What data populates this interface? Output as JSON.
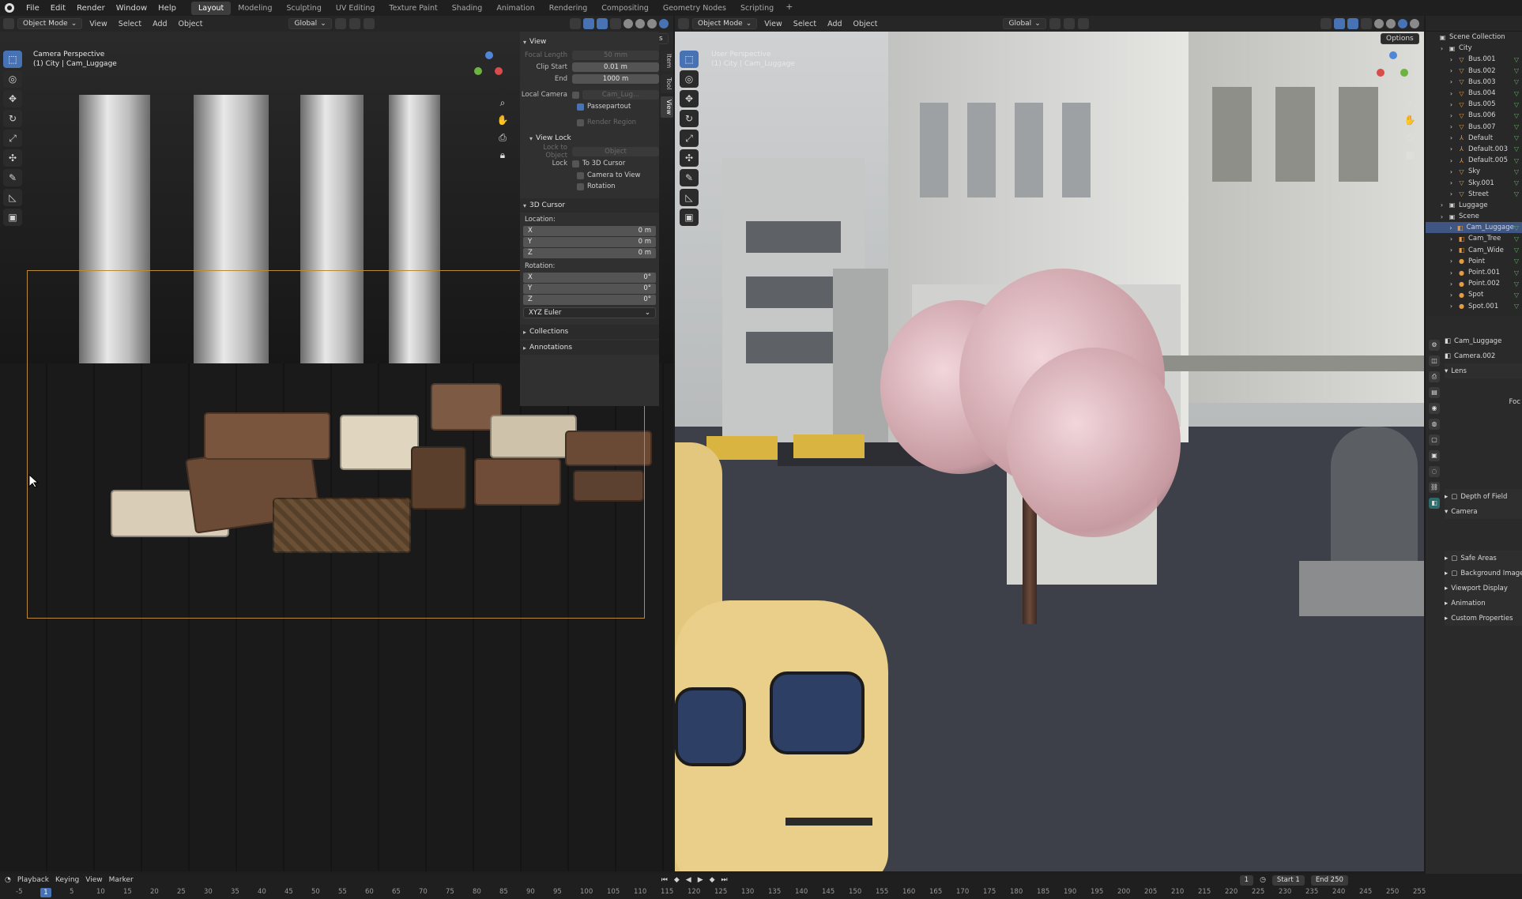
{
  "menu": {
    "items": [
      "File",
      "Edit",
      "Render",
      "Window",
      "Help"
    ],
    "workspaces": [
      "Layout",
      "Modeling",
      "Sculpting",
      "UV Editing",
      "Texture Paint",
      "Shading",
      "Animation",
      "Rendering",
      "Compositing",
      "Geometry Nodes",
      "Scripting"
    ],
    "active_workspace": "Layout",
    "add_tab": "+"
  },
  "left_viewport": {
    "mode": "Object Mode",
    "menus": [
      "View",
      "Select",
      "Add",
      "Object"
    ],
    "orientation": "Global",
    "options": "Options",
    "overlay_line1": "Camera Perspective",
    "overlay_line2": "(1) City | Cam_Luggage"
  },
  "npanel": {
    "tabs": [
      "Item",
      "Tool",
      "View"
    ],
    "view_header": "View",
    "focal_length_label": "Focal Length",
    "focal_length_value": "50 mm",
    "clip_start_label": "Clip Start",
    "clip_start_value": "0.01 m",
    "end_label": "End",
    "end_value": "1000 m",
    "local_camera_label": "Local Camera",
    "local_camera_value": "Cam_Lug...",
    "passepartout": "Passepartout",
    "render_region": "Render Region",
    "view_lock_header": "View Lock",
    "lock_to_object_label": "Lock to Object",
    "lock_to_object_value": "Object",
    "lock_label": "Lock",
    "to_3d_cursor": "To 3D Cursor",
    "camera_to_view": "Camera to View",
    "rotation_check": "Rotation",
    "cursor_header": "3D Cursor",
    "location_label": "Location:",
    "location": [
      {
        "axis": "X",
        "value": "0 m"
      },
      {
        "axis": "Y",
        "value": "0 m"
      },
      {
        "axis": "Z",
        "value": "0 m"
      }
    ],
    "rotation_label": "Rotation:",
    "rotation": [
      {
        "axis": "X",
        "value": "0°"
      },
      {
        "axis": "Y",
        "value": "0°"
      },
      {
        "axis": "Z",
        "value": "0°"
      }
    ],
    "rotation_mode": "XYZ Euler",
    "collections_header": "Collections",
    "annotations_header": "Annotations"
  },
  "right_viewport": {
    "mode": "Object Mode",
    "menus": [
      "View",
      "Select",
      "Add",
      "Object"
    ],
    "orientation": "Global",
    "options": "Options",
    "overlay_line1": "User Perspective",
    "overlay_line2": "(1) City | Cam_Luggage"
  },
  "outliner": {
    "rows": [
      {
        "name": "Scene Collection",
        "indent": 0,
        "icon": "▣",
        "color": "#cfcfcf"
      },
      {
        "name": "City",
        "indent": 1,
        "icon": "▣",
        "color": "#cfcfcf"
      },
      {
        "name": "Bus.001",
        "indent": 2,
        "icon": "▽",
        "color": "#e89a3c"
      },
      {
        "name": "Bus.002",
        "indent": 2,
        "icon": "▽",
        "color": "#e89a3c"
      },
      {
        "name": "Bus.003",
        "indent": 2,
        "icon": "▽",
        "color": "#e89a3c"
      },
      {
        "name": "Bus.004",
        "indent": 2,
        "icon": "▽",
        "color": "#e89a3c"
      },
      {
        "name": "Bus.005",
        "indent": 2,
        "icon": "▽",
        "color": "#e89a3c"
      },
      {
        "name": "Bus.006",
        "indent": 2,
        "icon": "▽",
        "color": "#e89a3c"
      },
      {
        "name": "Bus.007",
        "indent": 2,
        "icon": "▽",
        "color": "#e89a3c"
      },
      {
        "name": "Default",
        "indent": 2,
        "icon": "⅄",
        "color": "#e89a3c"
      },
      {
        "name": "Default.003",
        "indent": 2,
        "icon": "⅄",
        "color": "#e89a3c"
      },
      {
        "name": "Default.005",
        "indent": 2,
        "icon": "⅄",
        "color": "#e89a3c"
      },
      {
        "name": "Sky",
        "indent": 2,
        "icon": "▽",
        "color": "#e89a3c"
      },
      {
        "name": "Sky.001",
        "indent": 2,
        "icon": "▽",
        "color": "#e89a3c"
      },
      {
        "name": "Street",
        "indent": 2,
        "icon": "▽",
        "color": "#e89a3c"
      },
      {
        "name": "Luggage",
        "indent": 1,
        "icon": "▣",
        "color": "#cfcfcf"
      },
      {
        "name": "Scene",
        "indent": 1,
        "icon": "▣",
        "color": "#cfcfcf"
      },
      {
        "name": "Cam_Luggage",
        "indent": 2,
        "icon": "◧",
        "color": "#e89a3c",
        "selected": true
      },
      {
        "name": "Cam_Tree",
        "indent": 2,
        "icon": "◧",
        "color": "#e89a3c"
      },
      {
        "name": "Cam_Wide",
        "indent": 2,
        "icon": "◧",
        "color": "#e89a3c"
      },
      {
        "name": "Point",
        "indent": 2,
        "icon": "●",
        "color": "#e89a3c"
      },
      {
        "name": "Point.001",
        "indent": 2,
        "icon": "●",
        "color": "#e89a3c"
      },
      {
        "name": "Point.002",
        "indent": 2,
        "icon": "●",
        "color": "#e89a3c"
      },
      {
        "name": "Spot",
        "indent": 2,
        "icon": "●",
        "color": "#e89a3c"
      },
      {
        "name": "Spot.001",
        "indent": 2,
        "icon": "●",
        "color": "#e89a3c"
      }
    ]
  },
  "properties": {
    "object_name": "Cam_Luggage",
    "data_name": "Camera.002",
    "lens": "Lens",
    "focal_partial": "Foc",
    "depth_of_field": "Depth of Field",
    "camera": "Camera",
    "safe_areas": "Safe Areas",
    "background_images": "Background Images",
    "viewport_display": "Viewport Display",
    "animation": "Animation",
    "custom_properties": "Custom Properties"
  },
  "timeline": {
    "menus": [
      "Playback",
      "Keying",
      "View",
      "Marker"
    ],
    "current_frame": "1",
    "start_label": "Start",
    "start_value": "1",
    "end_label": "End",
    "end_value": "250",
    "ruler": [
      "-5",
      "1",
      "5",
      "10",
      "15",
      "20",
      "25",
      "30",
      "35",
      "40",
      "45",
      "50",
      "55",
      "60",
      "65",
      "70",
      "75",
      "80",
      "85",
      "90",
      "95",
      "100",
      "105",
      "110",
      "115",
      "120",
      "125",
      "130",
      "135",
      "140",
      "145",
      "150",
      "155",
      "160",
      "165",
      "170",
      "175",
      "180",
      "185",
      "190",
      "195",
      "200",
      "205",
      "210",
      "215",
      "220",
      "225",
      "230",
      "235",
      "240",
      "245",
      "250",
      "255"
    ]
  },
  "colors": {
    "accent": "#4772b3",
    "selection": "#3f5582",
    "camera_frame": "#b88a3a"
  }
}
